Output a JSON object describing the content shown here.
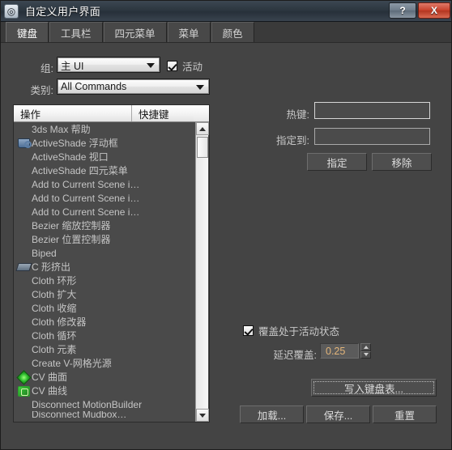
{
  "window": {
    "title": "自定义用户界面",
    "icon": "maxscript-logo-icon",
    "help_label": "?",
    "close_label": "X"
  },
  "tabs": [
    {
      "label": "键盘",
      "active": true
    },
    {
      "label": "工具栏",
      "active": false
    },
    {
      "label": "四元菜单",
      "active": false
    },
    {
      "label": "菜单",
      "active": false
    },
    {
      "label": "颜色",
      "active": false
    }
  ],
  "form": {
    "group_label": "组:",
    "group_value": "主 UI",
    "active_checkbox_label": "活动",
    "active_checked": true,
    "category_label": "类别:",
    "category_value": "All Commands"
  },
  "list": {
    "columns": [
      "操作",
      "快捷键"
    ],
    "items": [
      {
        "label": "3ds Max 帮助",
        "icon": ""
      },
      {
        "label": "ActiveShade 浮动框",
        "icon": "teapot"
      },
      {
        "label": "ActiveShade 视口",
        "icon": ""
      },
      {
        "label": "ActiveShade 四元菜单",
        "icon": ""
      },
      {
        "label": "Add to Current Scene i…",
        "icon": ""
      },
      {
        "label": "Add to Current Scene i…",
        "icon": ""
      },
      {
        "label": "Add to Current Scene i…",
        "icon": ""
      },
      {
        "label": "Bezier 缩放控制器",
        "icon": ""
      },
      {
        "label": "Bezier 位置控制器",
        "icon": ""
      },
      {
        "label": "Biped",
        "icon": ""
      },
      {
        "label": "C 形挤出",
        "icon": "cext"
      },
      {
        "label": "Cloth 环形",
        "icon": ""
      },
      {
        "label": "Cloth 扩大",
        "icon": ""
      },
      {
        "label": "Cloth 收缩",
        "icon": ""
      },
      {
        "label": "Cloth 修改器",
        "icon": ""
      },
      {
        "label": "Cloth 循环",
        "icon": ""
      },
      {
        "label": "Cloth 元素",
        "icon": ""
      },
      {
        "label": "Create V-网格光源",
        "icon": ""
      },
      {
        "label": "CV 曲面",
        "icon": "cvsurf"
      },
      {
        "label": "CV 曲线",
        "icon": "cvcurve"
      },
      {
        "label": "Disconnect MotionBuilder",
        "icon": ""
      },
      {
        "label": "Disconnect Mudbox…",
        "icon": ""
      }
    ]
  },
  "hotkey": {
    "hotkey_label": "热键:",
    "hotkey_value": "",
    "assigned_label": "指定到:",
    "assigned_value": "",
    "assign_button": "指定",
    "remove_button": "移除"
  },
  "overrides": {
    "active_override_label": "覆盖处于活动状态",
    "active_override_checked": true,
    "delay_label": "延迟覆盖:",
    "delay_value": "0.25"
  },
  "actions": {
    "write_keyboard_chart": "写入键盘表...",
    "load": "加载...",
    "save": "保存...",
    "reset": "重置"
  },
  "colors": {
    "window_bg": "#444444",
    "titlebar": "#2d3740",
    "close_red": "#c9422c",
    "list_bg": "#4a4a4a",
    "spinner_text": "#e3b57a"
  }
}
